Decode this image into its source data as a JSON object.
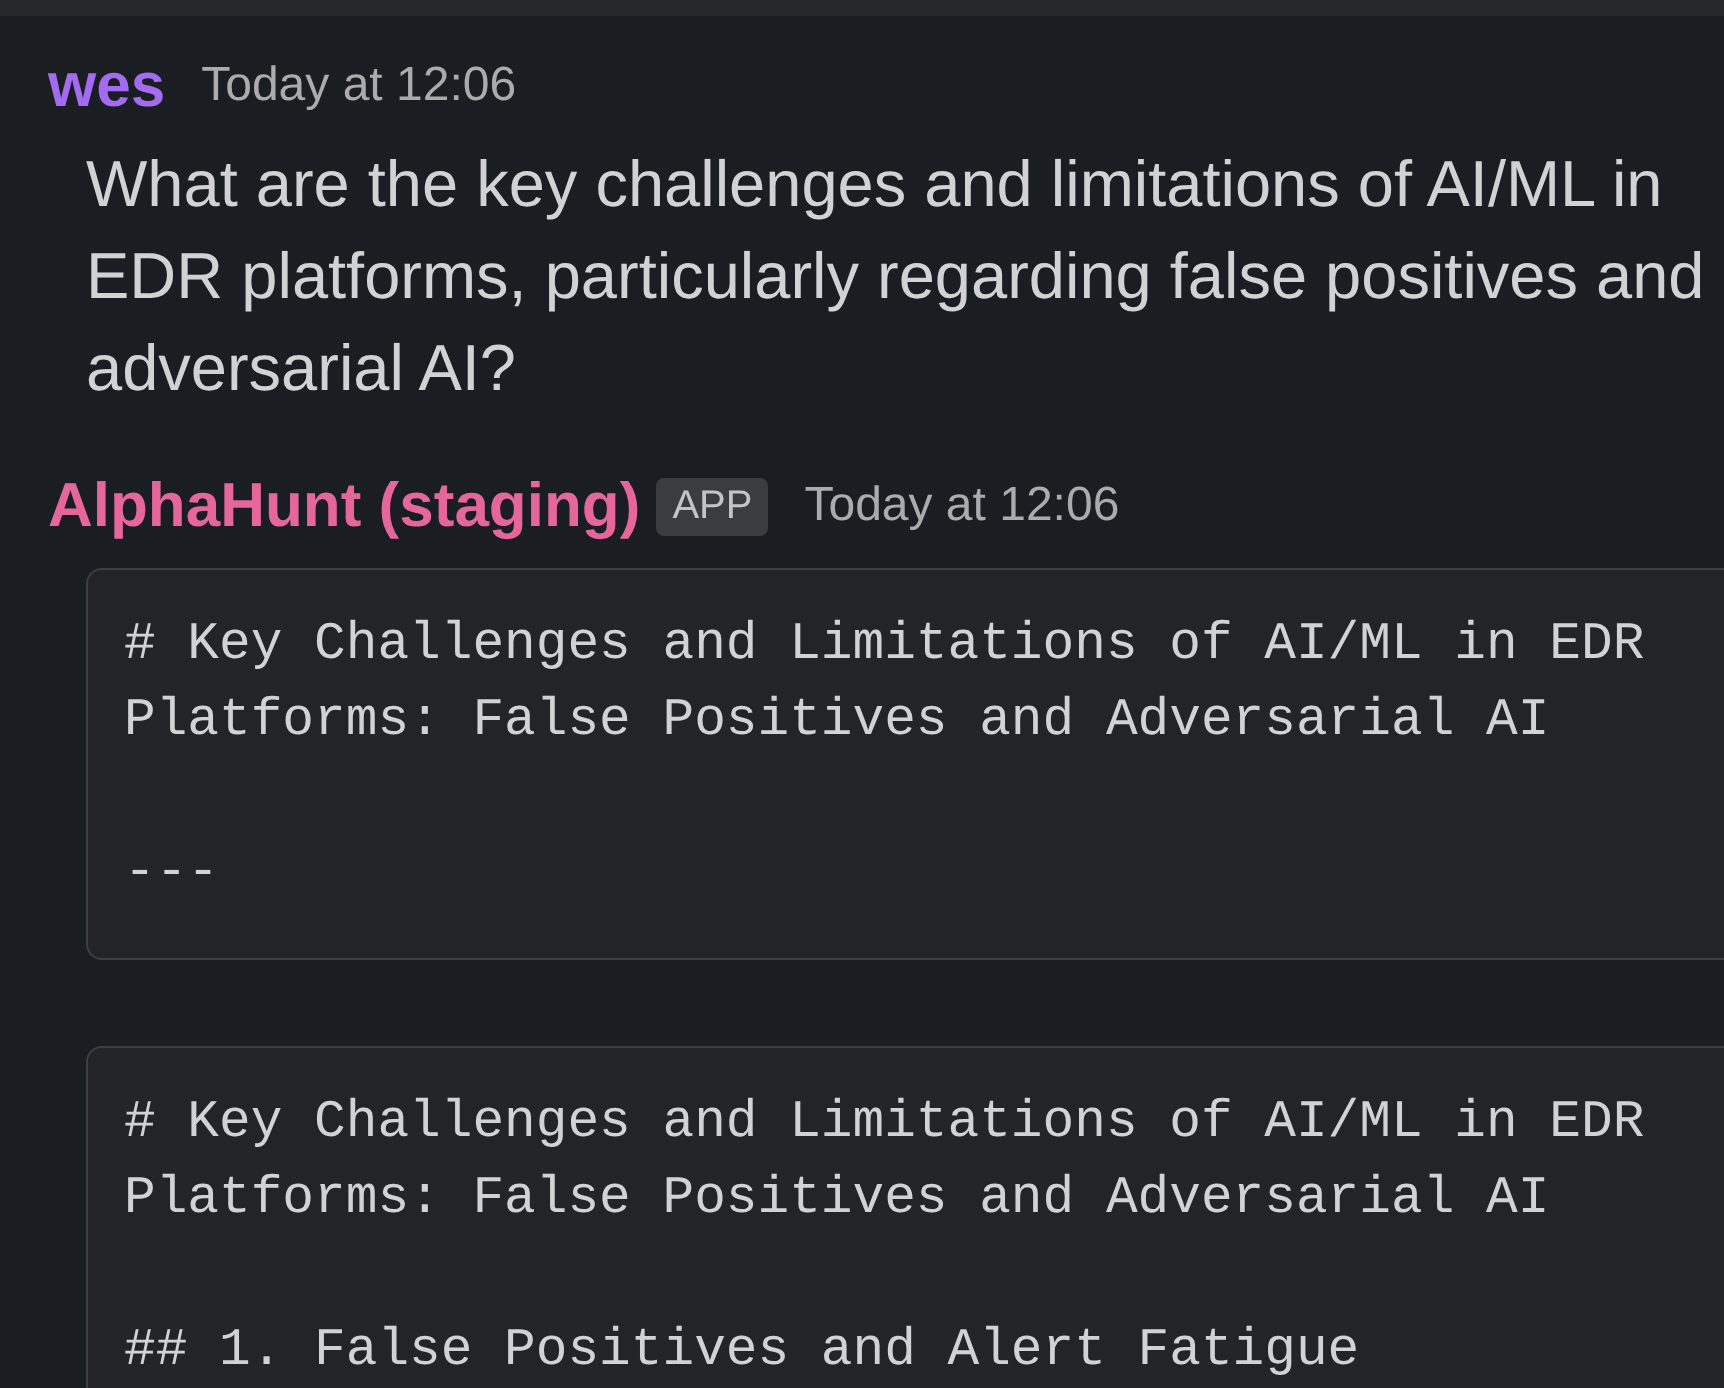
{
  "messages": [
    {
      "author": "wes",
      "color": "#a26bf0",
      "timestamp": "Today at 12:06",
      "text": "What are the key challenges and limitations of AI/ML in EDR platforms, particularly regarding false positives and adversarial AI?"
    },
    {
      "author": "AlphaHunt (staging)",
      "color": "#e5679a",
      "badge": "APP",
      "timestamp": "Today at 12:06",
      "code_blocks": [
        {
          "paragraphs": [
            "# Key Challenges and Limitations of AI/ML in EDR Platforms: False Positives and Adversarial AI",
            "---"
          ]
        },
        {
          "paragraphs": [
            "# Key Challenges and Limitations of AI/ML in EDR Platforms: False Positives and Adversarial AI",
            "## 1. False Positives and Alert Fatigue"
          ]
        }
      ]
    }
  ]
}
